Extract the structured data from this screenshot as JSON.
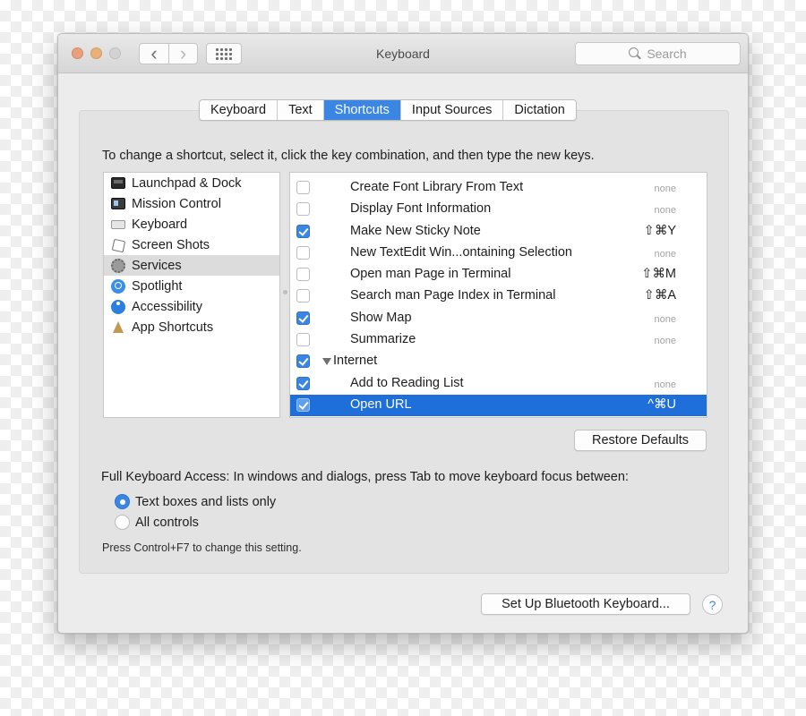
{
  "window": {
    "title": "Keyboard"
  },
  "toolbar": {
    "back_icon": "chevron-left-icon",
    "forward_icon": "chevron-right-icon",
    "show_all_icon": "grid-icon",
    "back_glyph": "‹",
    "forward_glyph": "›"
  },
  "search": {
    "placeholder": "Search",
    "icon": "search-icon"
  },
  "tabs": [
    {
      "label": "Keyboard",
      "active": false
    },
    {
      "label": "Text",
      "active": false
    },
    {
      "label": "Shortcuts",
      "active": true
    },
    {
      "label": "Input Sources",
      "active": false
    },
    {
      "label": "Dictation",
      "active": false
    }
  ],
  "instruction": "To change a shortcut, select it, click the key combination, and then type the new keys.",
  "categories": [
    {
      "label": "Launchpad & Dock",
      "icon": "launchpad-dock-icon",
      "selected": false
    },
    {
      "label": "Mission Control",
      "icon": "mission-control-icon",
      "selected": false
    },
    {
      "label": "Keyboard",
      "icon": "keyboard-icon",
      "selected": false
    },
    {
      "label": "Screen Shots",
      "icon": "screenshot-icon",
      "selected": false
    },
    {
      "label": "Services",
      "icon": "gear-icon",
      "selected": true
    },
    {
      "label": "Spotlight",
      "icon": "spotlight-icon",
      "selected": false
    },
    {
      "label": "Accessibility",
      "icon": "accessibility-icon",
      "selected": false
    },
    {
      "label": "App Shortcuts",
      "icon": "app-shortcuts-icon",
      "selected": false
    }
  ],
  "shortcuts": [
    {
      "label": "Create Font Library From Text",
      "key": "none",
      "checked": false
    },
    {
      "label": "Display Font Information",
      "key": "none",
      "checked": false
    },
    {
      "label": "Make New Sticky Note",
      "key": "⇧⌘Y",
      "checked": true
    },
    {
      "label": "New TextEdit Win...ontaining Selection",
      "key": "none",
      "checked": false
    },
    {
      "label": "Open man Page in Terminal",
      "key": "⇧⌘M",
      "checked": false
    },
    {
      "label": "Search man Page Index in Terminal",
      "key": "⇧⌘A",
      "checked": false
    },
    {
      "label": "Show Map",
      "key": "none",
      "checked": true
    },
    {
      "label": "Summarize",
      "key": "none",
      "checked": false
    },
    {
      "label": "Internet",
      "key": "",
      "checked": true,
      "group": true
    },
    {
      "label": "Add to Reading List",
      "key": "none",
      "checked": true
    },
    {
      "label": "Open URL",
      "key": "^⌘U",
      "checked": true,
      "selected": true
    }
  ],
  "restore_label": "Restore Defaults",
  "full_keyboard_access": {
    "label": "Full Keyboard Access: In windows and dialogs, press Tab to move keyboard focus between:",
    "options": [
      {
        "label": "Text boxes and lists only",
        "selected": true
      },
      {
        "label": "All controls",
        "selected": false
      }
    ],
    "hint": "Press Control+F7 to change this setting."
  },
  "bluetooth_label": "Set Up Bluetooth Keyboard...",
  "help_label": "?",
  "colors": {
    "accent": "#3a86e2",
    "selection": "#1e6fd9"
  }
}
